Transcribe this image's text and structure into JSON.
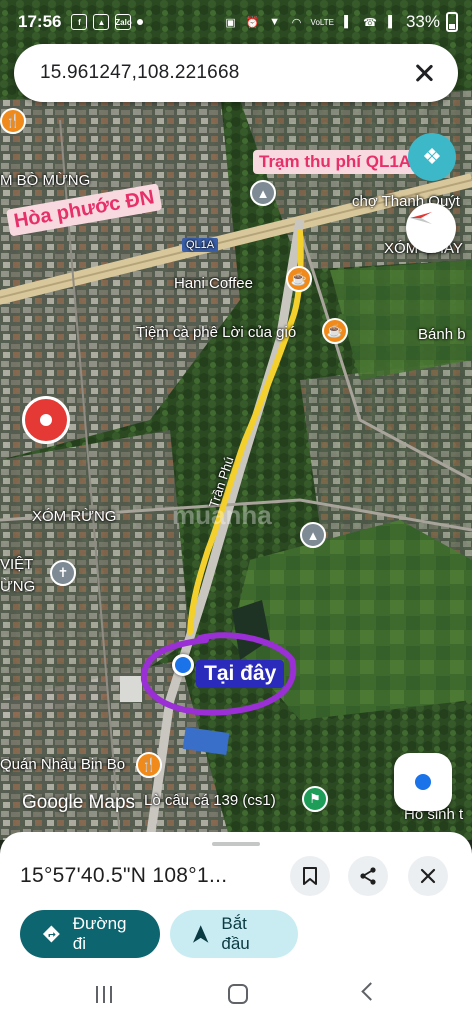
{
  "status_bar": {
    "time": "17:56",
    "notif_icons": [
      "facebook-icon",
      "gallery-icon",
      "zalo-icon",
      "dot-icon"
    ],
    "zalo_label": "Zalo",
    "right_icons": [
      "lock-icon",
      "alarm-icon",
      "location-icon",
      "wifi-icon",
      "signal-icon",
      "call-icon",
      "signal-icon"
    ],
    "network_label": "VoLTE",
    "battery_percent": "33%"
  },
  "search": {
    "query": "15.961247,108.221668"
  },
  "map": {
    "labels": {
      "toll": "Trạm thu phí QL1A",
      "hoa_phuoc": "Hòa phước ĐN",
      "here": "Tại đây",
      "bo_mung": "M BÒ MỪNG",
      "cho_thanh_quyt": "chợ Thanh Quýt",
      "xom_chay": "XÓM CHAY",
      "ql1a": "QL1A",
      "hani_coffee": "Hani Coffee",
      "tiem_ca_phe": "Tiệm cà phê Lời của gió",
      "banh_b": "Bánh b",
      "xom_rung": "XÓM RỪNG",
      "viet_line1": "VIỆT",
      "viet_line2": "ỪNG",
      "tran_phu": "Trần Phú",
      "quan_nhau": "Quán Nhậu Bin Bo",
      "lo_cau_ca": "Lò câu cá 139 (cs1)",
      "ho_sinh": "Hồ sinh t",
      "watermark": "muanha"
    },
    "google_logo": "Google Maps",
    "accent_colors": {
      "route": "#f3d02c",
      "circle": "#9a2fd6",
      "here_bg": "#2a2abb",
      "pink_label_bg": "#f8d9e0",
      "pink_label_text": "#e7306a"
    }
  },
  "sheet": {
    "title": "15°57'40.5\"N 108°1...",
    "directions_label": "Đường đi",
    "start_label": "Bắt đầu",
    "icons": {
      "save": "bookmark-icon",
      "share": "share-icon",
      "close": "close-icon",
      "directions": "directions-icon",
      "start": "navigation-arrow-icon"
    }
  },
  "nav": {
    "icons": [
      "recent-apps-icon",
      "home-icon",
      "back-icon"
    ]
  }
}
